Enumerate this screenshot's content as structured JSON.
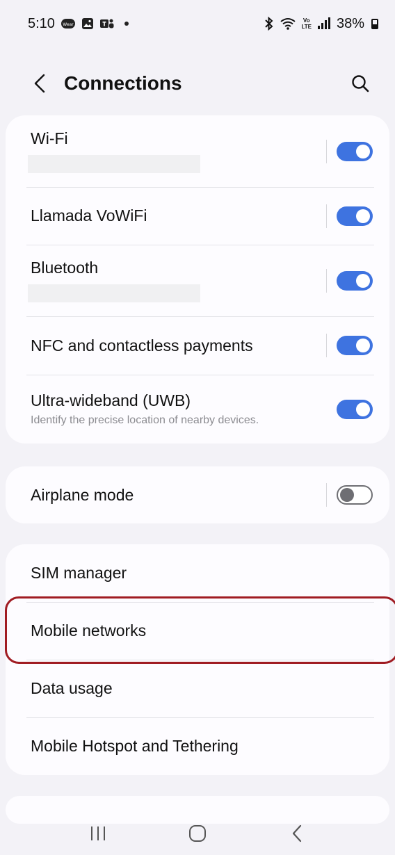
{
  "status_bar": {
    "time": "5:10",
    "battery_text": "38%",
    "icons": [
      "wear-icon",
      "gallery-icon",
      "teams-icon",
      "notification-dot",
      "bluetooth-icon",
      "wifi-icon",
      "volte-icon",
      "signal-icon",
      "battery-icon"
    ],
    "volte_top": "Vo",
    "volte_bottom": "LTE"
  },
  "header": {
    "title": "Connections"
  },
  "connectivity": {
    "items": [
      {
        "label": "Wi-Fi",
        "toggle": "on"
      },
      {
        "label": "Llamada VoWiFi",
        "toggle": "on"
      },
      {
        "label": "Bluetooth",
        "toggle": "on"
      },
      {
        "label": "NFC and contactless payments",
        "toggle": "on"
      },
      {
        "label": "Ultra-wideband (UWB)",
        "sublabel": "Identify the precise location of nearby devices.",
        "toggle": "on"
      }
    ]
  },
  "airplane": {
    "label": "Airplane mode",
    "toggle": "off"
  },
  "network": {
    "items": [
      {
        "label": "SIM manager"
      },
      {
        "label": "Mobile networks"
      },
      {
        "label": "Data usage"
      },
      {
        "label": "Mobile Hotspot and Tethering"
      }
    ]
  },
  "colors": {
    "accent": "#3e73e0",
    "highlight": "#a01c22",
    "background": "#f3f2f7",
    "card": "#fdfcff"
  }
}
